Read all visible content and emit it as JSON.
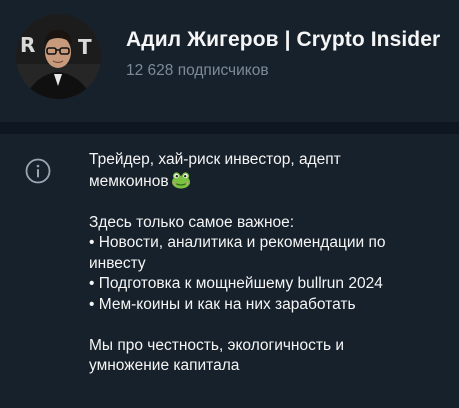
{
  "channel": {
    "title": "Адил Жигеров | Crypto Insider",
    "subscribers": "12 628 подписчиков",
    "avatar_icon": "channel-avatar-photo"
  },
  "about": {
    "icon": "info-circle-icon",
    "lines": [
      "Трейдер, хай-риск инвестор, адепт",
      "мемкоинов",
      "",
      "Здесь только самое важное:",
      " • Новости, аналитика и рекомендации по",
      "инвесту",
      " • Подготовка к мощнейшему bullrun 2024",
      " • Мем-коины и как на них заработать",
      "",
      "Мы про честность, экологичность и",
      "умножение капитала"
    ],
    "emoji": "frog-emoji"
  },
  "colors": {
    "background": "#17212b",
    "divider": "#0e1621",
    "text": "#f5f5f5",
    "muted": "#7d8b99"
  }
}
